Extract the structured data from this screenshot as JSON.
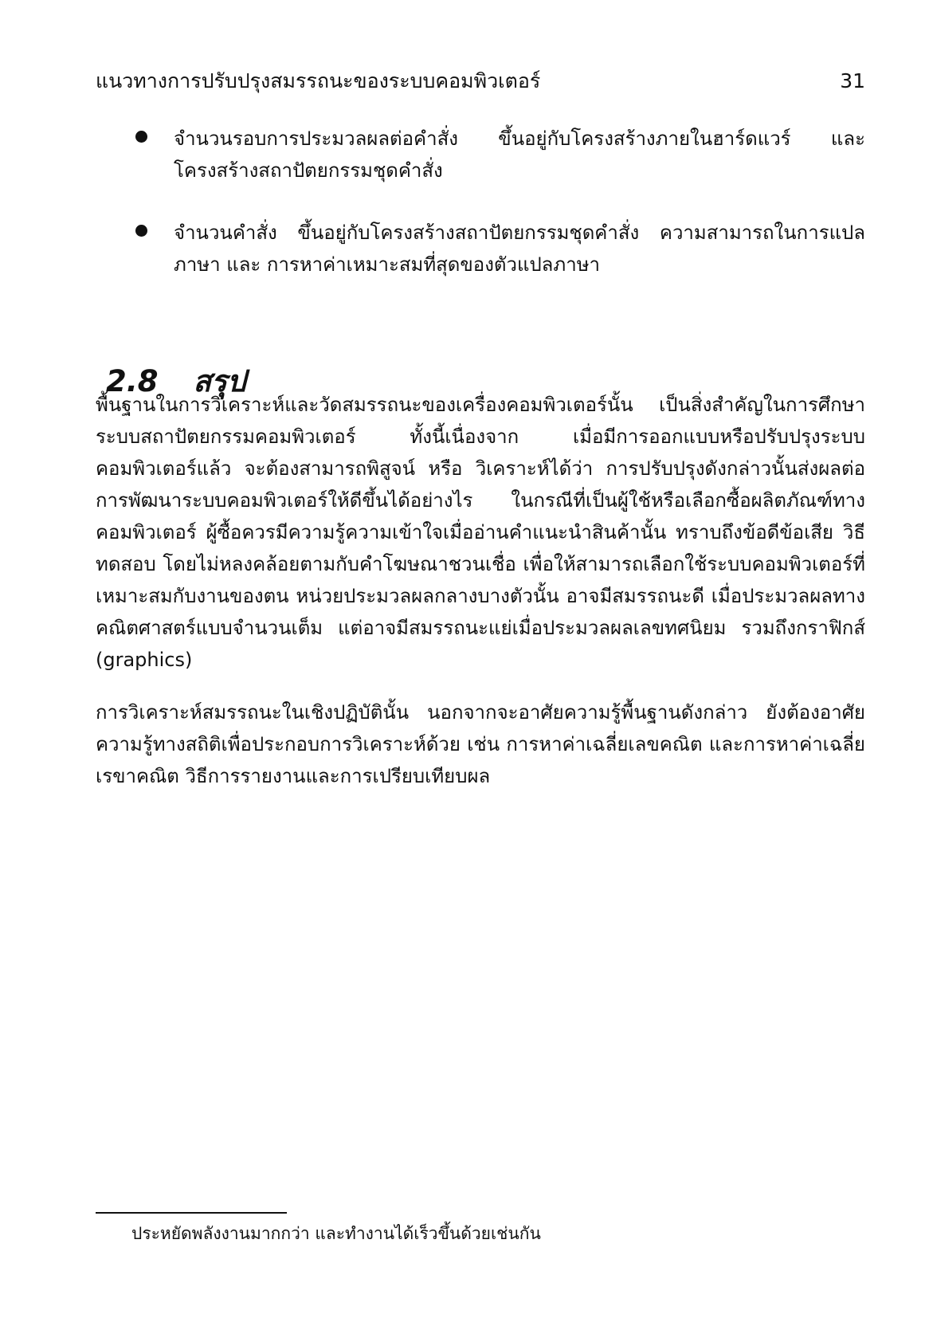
{
  "header": {
    "running_title": "แนวทางการปรับปรุงสมรรถนะของระบบคอมพิวเตอร์",
    "page_number": "31"
  },
  "bullets": [
    "จำนวนรอบการประมวลผลต่อคำสั่ง ขึ้นอยู่กับโครงสร้างภายในฮาร์ดแวร์ และโครงสร้างสถาปัตยกรรมชุดคำสั่ง",
    "จำนวนคำสั่ง ขึ้นอยู่กับโครงสร้างสถาปัตยกรรมชุดคำสั่ง ความสามารถในการแปลภาษา และ การหาค่าเหมาะสมที่สุดของตัวแปลภาษา"
  ],
  "section": {
    "number": "2.8",
    "title": "สรุป"
  },
  "paragraphs": [
    "พื้นฐานในการวิเคราะห์และวัดสมรรถนะของเครื่องคอมพิวเตอร์นั้น เป็นสิ่งสำคัญในการศึกษาระบบสถาปัตยกรรมคอมพิวเตอร์ ทั้งนี้เนื่องจาก เมื่อมีการออกแบบหรือปรับปรุงระบบคอมพิวเตอร์แล้ว จะต้องสามารถพิสูจน์ หรือ วิเคราะห์ได้ว่า การปรับปรุงดังกล่าวนั้นส่งผลต่อการพัฒนาระบบคอมพิวเตอร์ให้ดีขึ้นได้อย่างไร ในกรณีที่เป็นผู้ใช้หรือเลือกซื้อผลิตภัณฑ์ทางคอมพิวเตอร์ ผู้ซื้อควรมีความรู้ความเข้าใจเมื่ออ่านคำแนะนำสินค้านั้น ทราบถึงข้อดีข้อเสีย วิธีทดสอบ โดยไม่หลงคล้อยตามกับคำโฆษณาชวนเชื่อ เพื่อให้สามารถเลือกใช้ระบบคอมพิวเตอร์ที่เหมาะสมกับงานของตน หน่วยประมวลผลกลางบางตัวนั้น อาจมีสมรรถนะดี เมื่อประมวลผลทางคณิตศาสตร์แบบจำนวนเต็ม แต่อาจมีสมรรถนะแย่เมื่อประมวลผลเลขทศนิยม รวมถึงกราฟิกส์ (graphics)",
    "การวิเคราะห์สมรรถนะในเชิงปฏิบัตินั้น นอกจากจะอาศัยความรู้พื้นฐานดังกล่าว ยังต้องอาศัยความรู้ทางสถิติเพื่อประกอบการวิเคราะห์ด้วย เช่น การหาค่าเฉลี่ยเลขคณิต และการหาค่าเฉลี่ยเรขาคณิต วิธีการรายงานและการเปรียบเทียบผล"
  ],
  "footnote": {
    "text": "ประหยัดพลังงานมากกว่า และทำงานได้เร็วขึ้นด้วยเช่นกัน"
  }
}
